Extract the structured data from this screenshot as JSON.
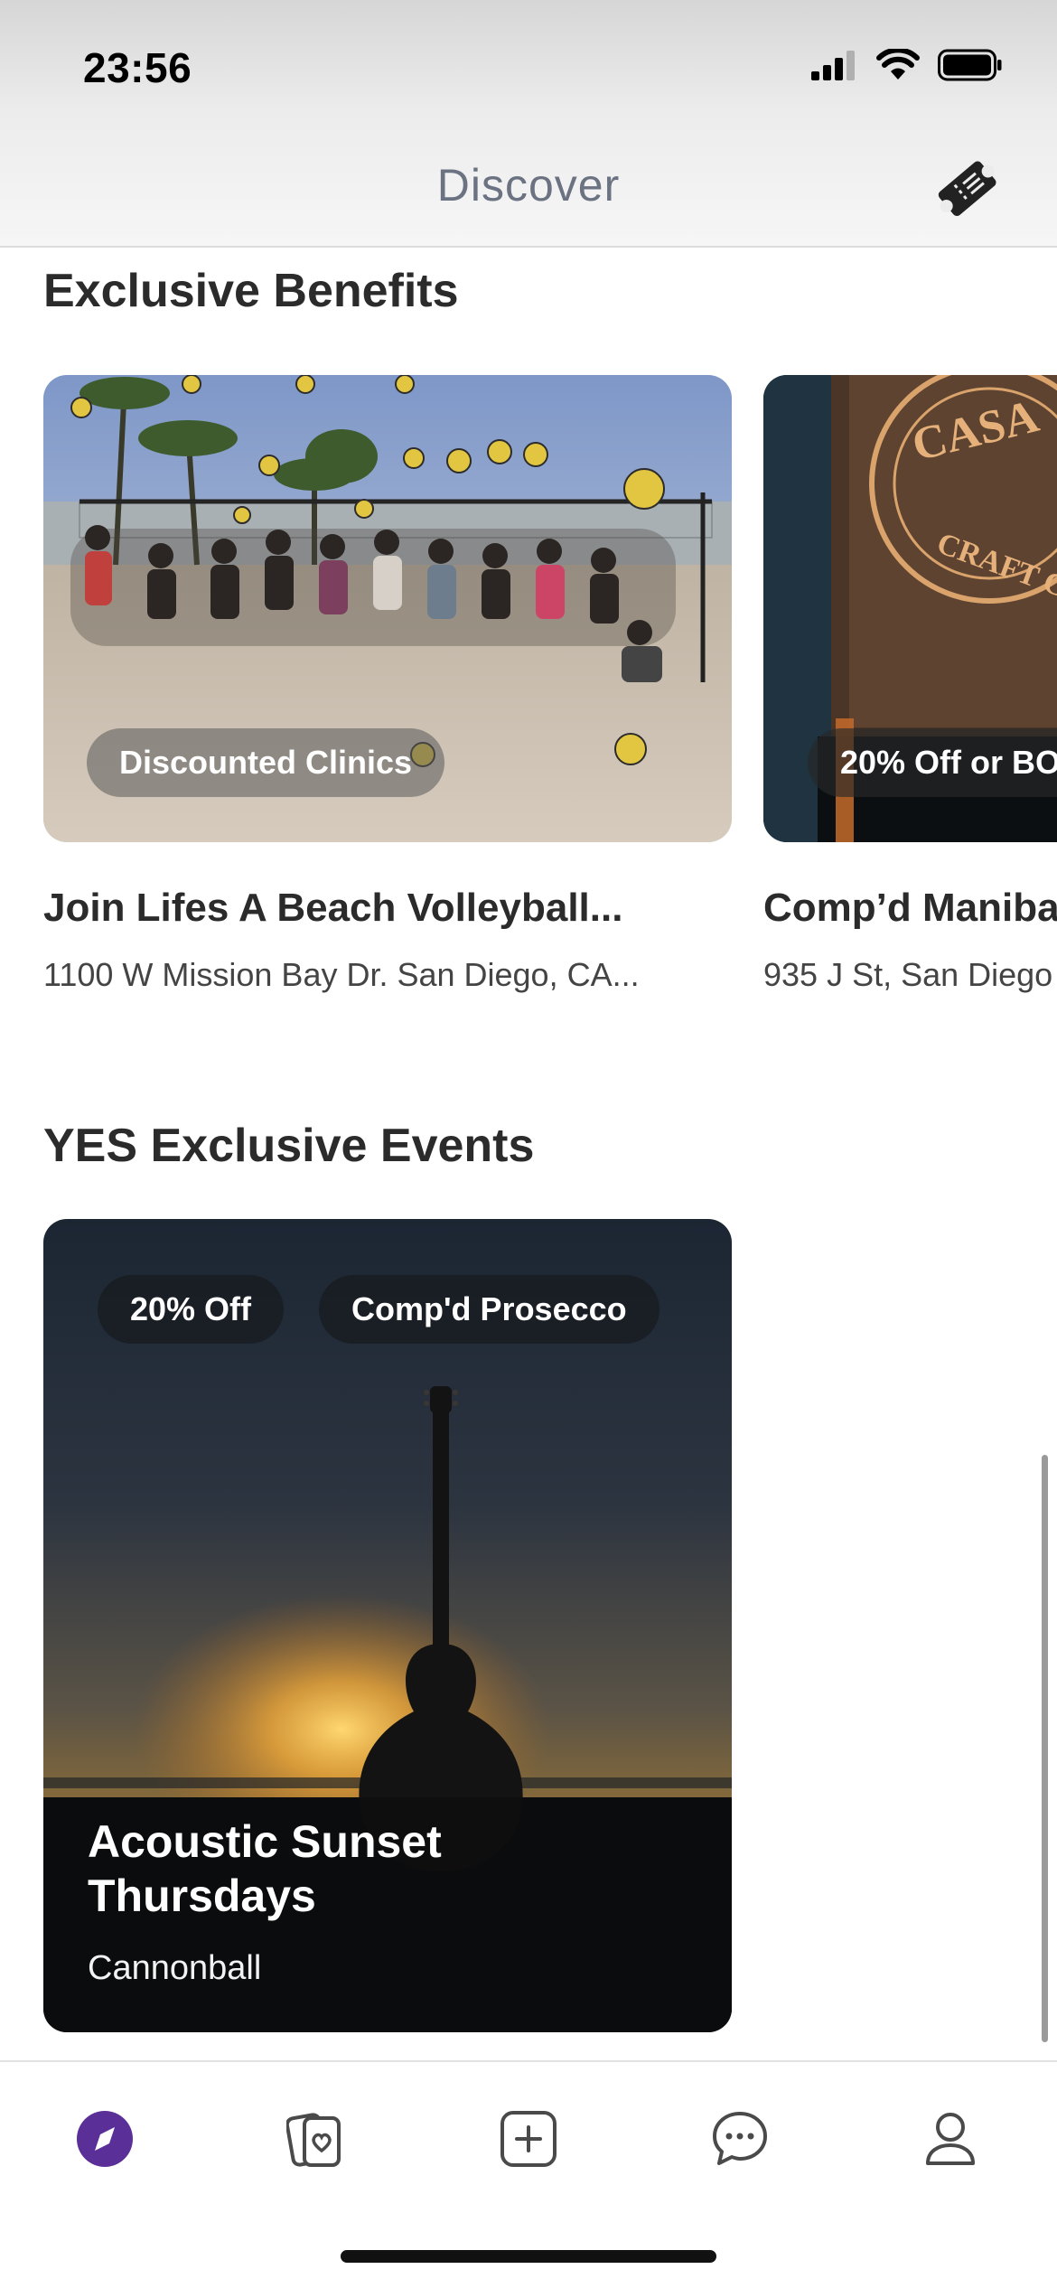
{
  "status_bar": {
    "time": "23:56"
  },
  "header": {
    "title": "Discover"
  },
  "benefits": {
    "section_title": "Exclusive Benefits",
    "cards": [
      {
        "tag": "Discounted Clinics",
        "title": "Join Lifes A Beach Volleyball...",
        "address": "1100 W Mission Bay Dr. San Diego, CA..."
      },
      {
        "tag": "20% Off or BO",
        "title": "Comp’d Maniba",
        "address": "935 J St, San Diego"
      }
    ]
  },
  "events": {
    "section_title": "YES Exclusive Events",
    "cards": [
      {
        "tags": [
          "20% Off",
          "Comp'd Prosecco"
        ],
        "title_line1": "Acoustic Sunset",
        "title_line2": "Thursdays",
        "venue": "Cannonball"
      }
    ]
  },
  "tabbar": {
    "items": [
      {
        "icon": "compass-icon",
        "active": true
      },
      {
        "icon": "cards-heart-icon",
        "active": false
      },
      {
        "icon": "add-square-icon",
        "active": false
      },
      {
        "icon": "chat-bubble-icon",
        "active": false
      },
      {
        "icon": "profile-icon",
        "active": false
      }
    ]
  },
  "colors": {
    "accent": "#5b2f98",
    "icon_gray": "#4a4a4a",
    "text_dark": "#2b2b2b",
    "header_title": "#6b7281"
  }
}
